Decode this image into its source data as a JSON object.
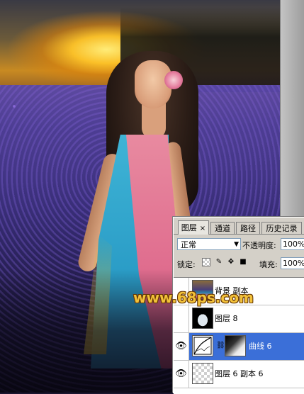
{
  "watermark": {
    "text": "www.68ps.com"
  },
  "layers_panel": {
    "tabs": [
      {
        "label": "图层",
        "close": "×",
        "active": true
      },
      {
        "label": "通道",
        "active": false
      },
      {
        "label": "路径",
        "active": false
      },
      {
        "label": "历史记录",
        "active": false
      }
    ],
    "blend_mode": "正常",
    "opacity_label": "不透明度:",
    "opacity_value": "100%",
    "lock_label": "锁定:",
    "fill_label": "填充:",
    "fill_value": "100%",
    "layers": [
      {
        "name": "背景 副本",
        "visible": false,
        "thumbnail": "photo",
        "selected": false
      },
      {
        "name": "图层 8",
        "visible": false,
        "thumbnail": "girl-silhouette",
        "selected": false
      },
      {
        "name": "曲线 6",
        "visible": true,
        "thumbnail": "curves-adjustment",
        "mask": true,
        "selected": true
      },
      {
        "name": "图层 6 副本 6",
        "visible": true,
        "thumbnail": "transparent",
        "selected": false
      }
    ]
  },
  "icons": {
    "visibility": "eye-icon",
    "lock_transparent": "checker-icon",
    "lock_paint": "brush-icon",
    "lock_move": "move-icon",
    "lock_all": "lock-icon",
    "link": "chain-link-icon"
  },
  "colors": {
    "selection": "#3b6fd8",
    "panel_bg": "#d4d0c8",
    "watermark": "#f3c23a"
  }
}
